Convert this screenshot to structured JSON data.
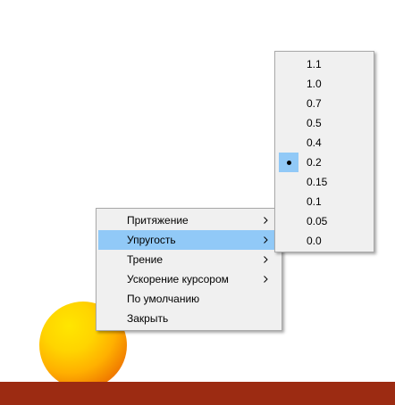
{
  "context_menu": {
    "items": [
      {
        "label": "Притяжение",
        "submenu": true
      },
      {
        "label": "Упругость",
        "submenu": true
      },
      {
        "label": "Трение",
        "submenu": true
      },
      {
        "label": "Ускорение курсором",
        "submenu": true
      },
      {
        "label": "По умолчанию",
        "submenu": false
      },
      {
        "label": "Закрыть",
        "submenu": false
      }
    ],
    "highlighted_item": "Упругость"
  },
  "submenu": {
    "options": [
      "1.1",
      "1.0",
      "0.7",
      "0.5",
      "0.4",
      "0.2",
      "0.15",
      "0.1",
      "0.05",
      "0.0"
    ],
    "selected": "0.2"
  },
  "scene": {
    "ball_colors": [
      "#ffe600",
      "#ffb000",
      "#c84a00"
    ],
    "floor_color": "#9c2b12",
    "menu_background": "#f0f0f0",
    "highlight_color": "#91c9f7"
  },
  "icons": {
    "submenu_arrow": "chevron-right-icon",
    "radio_mark": "bullet-icon"
  }
}
